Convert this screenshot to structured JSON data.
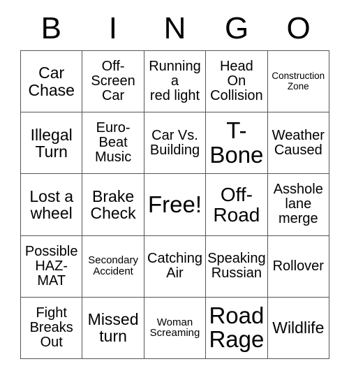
{
  "card": {
    "header_letters": [
      "B",
      "I",
      "N",
      "G",
      "O"
    ],
    "columns": 5,
    "rows": 5,
    "border_color": "#555555",
    "background_color": "#ffffff",
    "text_color": "#000000",
    "cells": [
      {
        "text": "Car\nChase",
        "size": "md"
      },
      {
        "text": "Off-\nScreen\nCar",
        "size": "sm"
      },
      {
        "text": "Running\na\nred light",
        "size": "sm"
      },
      {
        "text": "Head\nOn\nCollision",
        "size": "sm"
      },
      {
        "text": "Construction\nZone",
        "size": "xxs"
      },
      {
        "text": "Illegal\nTurn",
        "size": "md"
      },
      {
        "text": "Euro-\nBeat\nMusic",
        "size": "sm"
      },
      {
        "text": "Car Vs.\nBuilding",
        "size": "sm"
      },
      {
        "text": "T-\nBone",
        "size": "xl"
      },
      {
        "text": "Weather\nCaused",
        "size": "sm"
      },
      {
        "text": "Lost a\nwheel",
        "size": "md"
      },
      {
        "text": "Brake\nCheck",
        "size": "md"
      },
      {
        "text": "Free!",
        "size": "xl"
      },
      {
        "text": "Off-\nRoad",
        "size": "lg"
      },
      {
        "text": "Asshole\nlane\nmerge",
        "size": "sm"
      },
      {
        "text": "Possible\nHAZ-\nMAT",
        "size": "sm"
      },
      {
        "text": "Secondary\nAccident",
        "size": "xs"
      },
      {
        "text": "Catching\nAir",
        "size": "sm"
      },
      {
        "text": "Speaking\nRussian",
        "size": "sm"
      },
      {
        "text": "Rollover",
        "size": "sm"
      },
      {
        "text": "Fight\nBreaks\nOut",
        "size": "sm"
      },
      {
        "text": "Missed\nturn",
        "size": "md"
      },
      {
        "text": "Woman\nScreaming",
        "size": "xs"
      },
      {
        "text": "Road\nRage",
        "size": "xl"
      },
      {
        "text": "Wildlife",
        "size": "md"
      }
    ]
  }
}
